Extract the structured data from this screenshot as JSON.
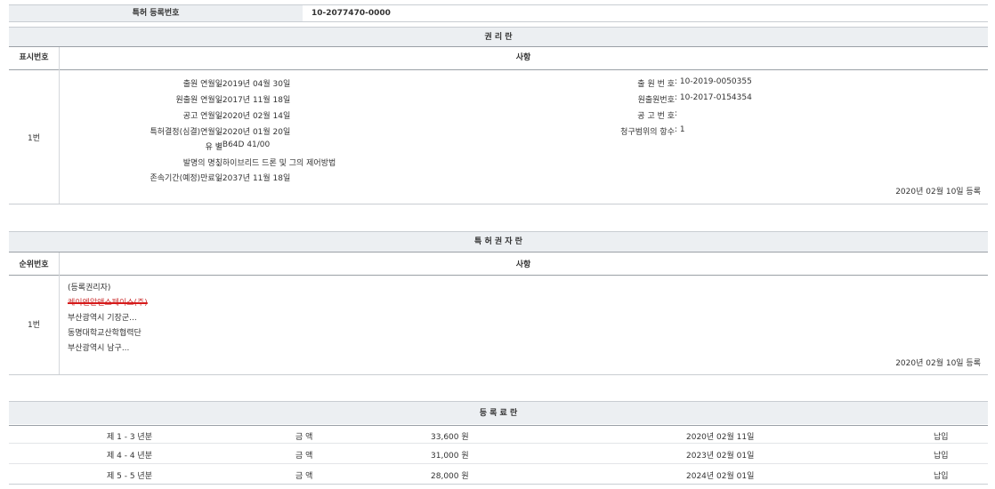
{
  "reg_number": {
    "label": "특허 등록번호",
    "value": "10-2077470-0000"
  },
  "rights_section": {
    "title": "권 리 란",
    "col_no": "표시번호",
    "col_content": "사항",
    "row_no": "1번",
    "left_fields": [
      {
        "label": "출원 연월일",
        "value": "2019년 04월 30일"
      },
      {
        "label": "원출원 연월일",
        "value": "2017년 11월 18일"
      },
      {
        "label": "공고 연월일",
        "value": "2020년 02월 14일"
      },
      {
        "label": "특허결정(심결)연월일",
        "value": "2020년 01월 20일"
      },
      {
        "label": "유 별",
        "value": "B64D 41/00"
      },
      {
        "label": "발명의 명칭",
        "value": "하이브리드 드론 및 그의 제어방법"
      },
      {
        "label": "존속기간(예정)만료일",
        "value": "2037년 11월 18일"
      }
    ],
    "right_fields": [
      {
        "label": "출 원 번 호",
        "value": "10-2019-0050355"
      },
      {
        "label": "원출원번호",
        "value": "10-2017-0154354"
      },
      {
        "label": "공 고 번 호",
        "value": ""
      },
      {
        "label": "청구범위의 항수",
        "value": "1"
      }
    ],
    "registered": "2020년 02월 10일 등록"
  },
  "holder_section": {
    "title": "특 허 권 자 란",
    "col_no": "순위번호",
    "col_content": "사항",
    "row_no": "1번",
    "heading": "(등록권리자)",
    "lines": [
      {
        "text": "케이엔알앤스페이스(주)",
        "struck": true
      },
      {
        "text": "부산광역시 기장군...",
        "struck": false
      },
      {
        "text": "동명대학교산학협력단",
        "struck": false
      },
      {
        "text": "부산광역시 남구...",
        "struck": false
      }
    ],
    "registered": "2020년 02월 10일 등록"
  },
  "fee_section": {
    "title": "등 록 료 란",
    "rows": [
      {
        "period": "제 1 - 3 년분",
        "amount_label": "금 액",
        "amount": "33,600 원",
        "date": "2020년 02월 11일",
        "status": "납입"
      },
      {
        "period": "제 4 - 4 년분",
        "amount_label": "금 액",
        "amount": "31,000 원",
        "date": "2023년 02월 01일",
        "status": "납입"
      },
      {
        "period": "제 5 - 5 년분",
        "amount_label": "금 액",
        "amount": "28,000 원",
        "date": "2024년 02월 01일",
        "status": "납입"
      }
    ]
  }
}
